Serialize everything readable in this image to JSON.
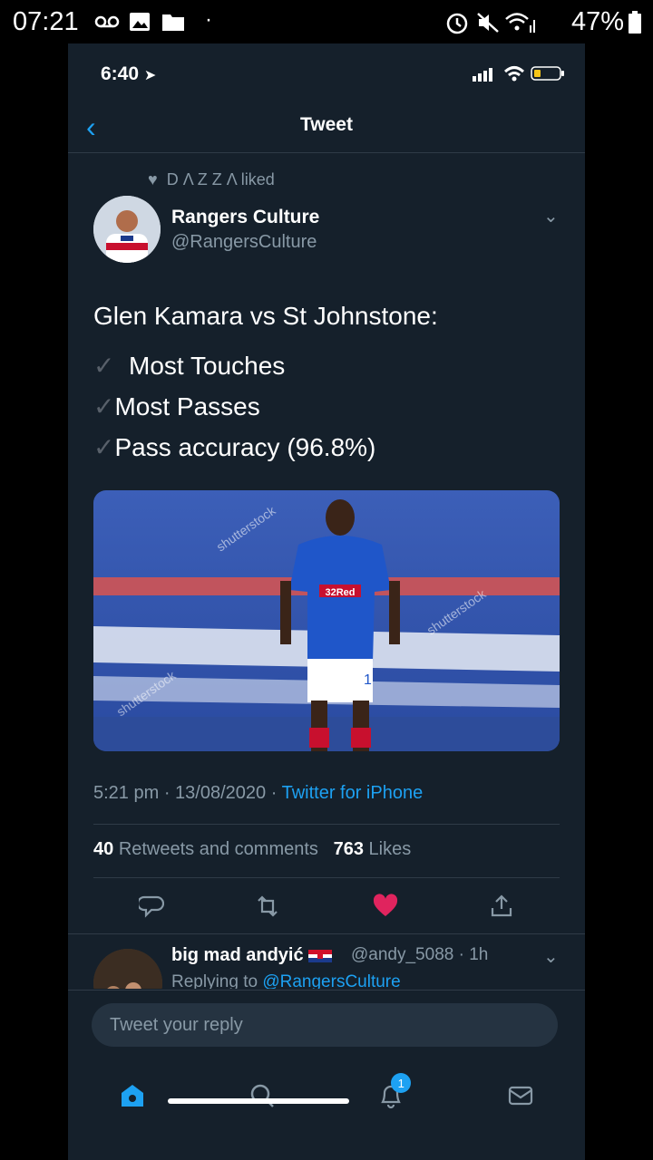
{
  "android_status": {
    "time": "07:21",
    "battery": "47%"
  },
  "ios_status": {
    "time": "6:40"
  },
  "nav": {
    "title": "Tweet"
  },
  "social_context": {
    "text": "D Λ Z Z Λ liked"
  },
  "tweet": {
    "author_name": "Rangers Culture",
    "author_handle": "@RangersCulture",
    "headline": "Glen Kamara vs St Johnstone:",
    "checklist": [
      "Most Touches",
      "Most Passes",
      "Pass accuracy (96.8%)"
    ],
    "check_glyph": "✓",
    "media": {
      "watermark": "shutterstock",
      "sponsor": "32Red",
      "shirt_number": "1"
    },
    "time": "5:21 pm",
    "date": "13/08/2020",
    "source": "Twitter for iPhone",
    "retweets_count": "40",
    "retweets_label": "Retweets and comments",
    "likes_count": "763",
    "likes_label": "Likes"
  },
  "reply": {
    "name": "big mad andyić",
    "handle": "@andy_5088 · 1h",
    "replying_prefix": "Replying to",
    "replying_handle": "@RangersCulture"
  },
  "compose": {
    "placeholder": "Tweet your reply"
  },
  "tabbar": {
    "notifications_badge": "1"
  },
  "colors": {
    "background": "#15202b",
    "accent": "#1da1f2",
    "like": "#e0245e",
    "muted": "#8899a6"
  }
}
